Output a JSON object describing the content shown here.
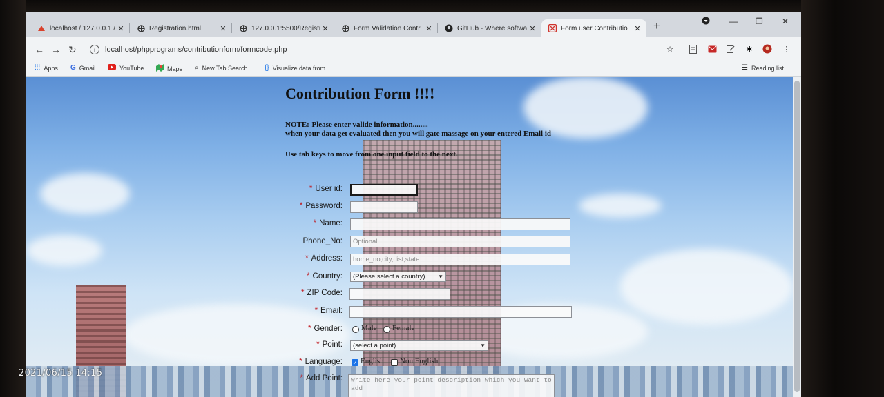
{
  "browser": {
    "tabs": [
      {
        "title": "localhost / 127.0.0.1 / ",
        "icon": "phpmyadmin-icon"
      },
      {
        "title": "Registration.html",
        "icon": "globe-icon"
      },
      {
        "title": "127.0.0.1:5500/Registr",
        "icon": "globe-icon"
      },
      {
        "title": "Form Validation Contr",
        "icon": "globe-icon"
      },
      {
        "title": "GitHub - Where softwa",
        "icon": "github-icon"
      },
      {
        "title": "Form user Contributio",
        "icon": "xampp-icon"
      }
    ],
    "new_tab": "+",
    "url": "localhost/phpprograms/contributionform/formcode.php",
    "bookmarks": [
      {
        "label": "Apps",
        "icon": "apps-grid-icon"
      },
      {
        "label": "Gmail",
        "icon": "google-icon"
      },
      {
        "label": "YouTube",
        "icon": "youtube-icon"
      },
      {
        "label": "Maps",
        "icon": "maps-icon"
      },
      {
        "label": "New Tab Search",
        "icon": "search-icon"
      },
      {
        "label": "Visualize data from...",
        "icon": "code-braces-icon"
      }
    ],
    "reading_list": "Reading list"
  },
  "form": {
    "title": "Contribution Form !!!!",
    "note_line1": "NOTE:-Please enter valide information........",
    "note_line2": "when your data get evaluated then you will gate massage on your entered Email id",
    "tab_note": "Use tab keys to move from one input field to the next.",
    "required_mark": "*",
    "labels": {
      "user_id": "User id:",
      "password": "Password:",
      "name": "Name:",
      "phone": "Phone_No:",
      "address": "Address:",
      "country": "Country:",
      "zip": "ZIP Code:",
      "email": "Email:",
      "gender": "Gender:",
      "point": "Point:",
      "language": "Language:",
      "add_point": "Add Point:"
    },
    "placeholders": {
      "phone": "Optional",
      "address": "home_no,city,dist,state",
      "add_point": "Write here your point description which you want to add"
    },
    "country_selected": "(Please select a country)",
    "point_selected": "(select a point)",
    "gender_options": [
      "Male",
      "Female"
    ],
    "language_options": [
      "English",
      "Non English"
    ],
    "language_english_checked": true
  },
  "overlay": {
    "timestamp": "2021/06/15 14:15"
  }
}
